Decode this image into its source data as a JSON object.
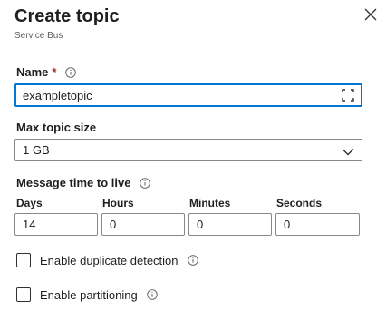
{
  "header": {
    "title": "Create topic",
    "subtitle": "Service Bus"
  },
  "name_field": {
    "label": "Name",
    "required_marker": "*",
    "value": "exampletopic"
  },
  "max_topic_size": {
    "label": "Max topic size",
    "selected": "1 GB"
  },
  "message_ttl": {
    "label": "Message time to live",
    "fields": [
      {
        "label": "Days",
        "value": "14"
      },
      {
        "label": "Hours",
        "value": "0"
      },
      {
        "label": "Minutes",
        "value": "0"
      },
      {
        "label": "Seconds",
        "value": "0"
      }
    ]
  },
  "options": {
    "duplicate_detection": {
      "label": "Enable duplicate detection",
      "checked": false
    },
    "partitioning": {
      "label": "Enable partitioning",
      "checked": false
    }
  },
  "colors": {
    "focus_border": "#0078d4",
    "required": "#a4262c",
    "border": "#8a8886"
  },
  "icons": [
    "close-icon",
    "info-icon",
    "chevron-down-icon",
    "input-helper-icon"
  ]
}
